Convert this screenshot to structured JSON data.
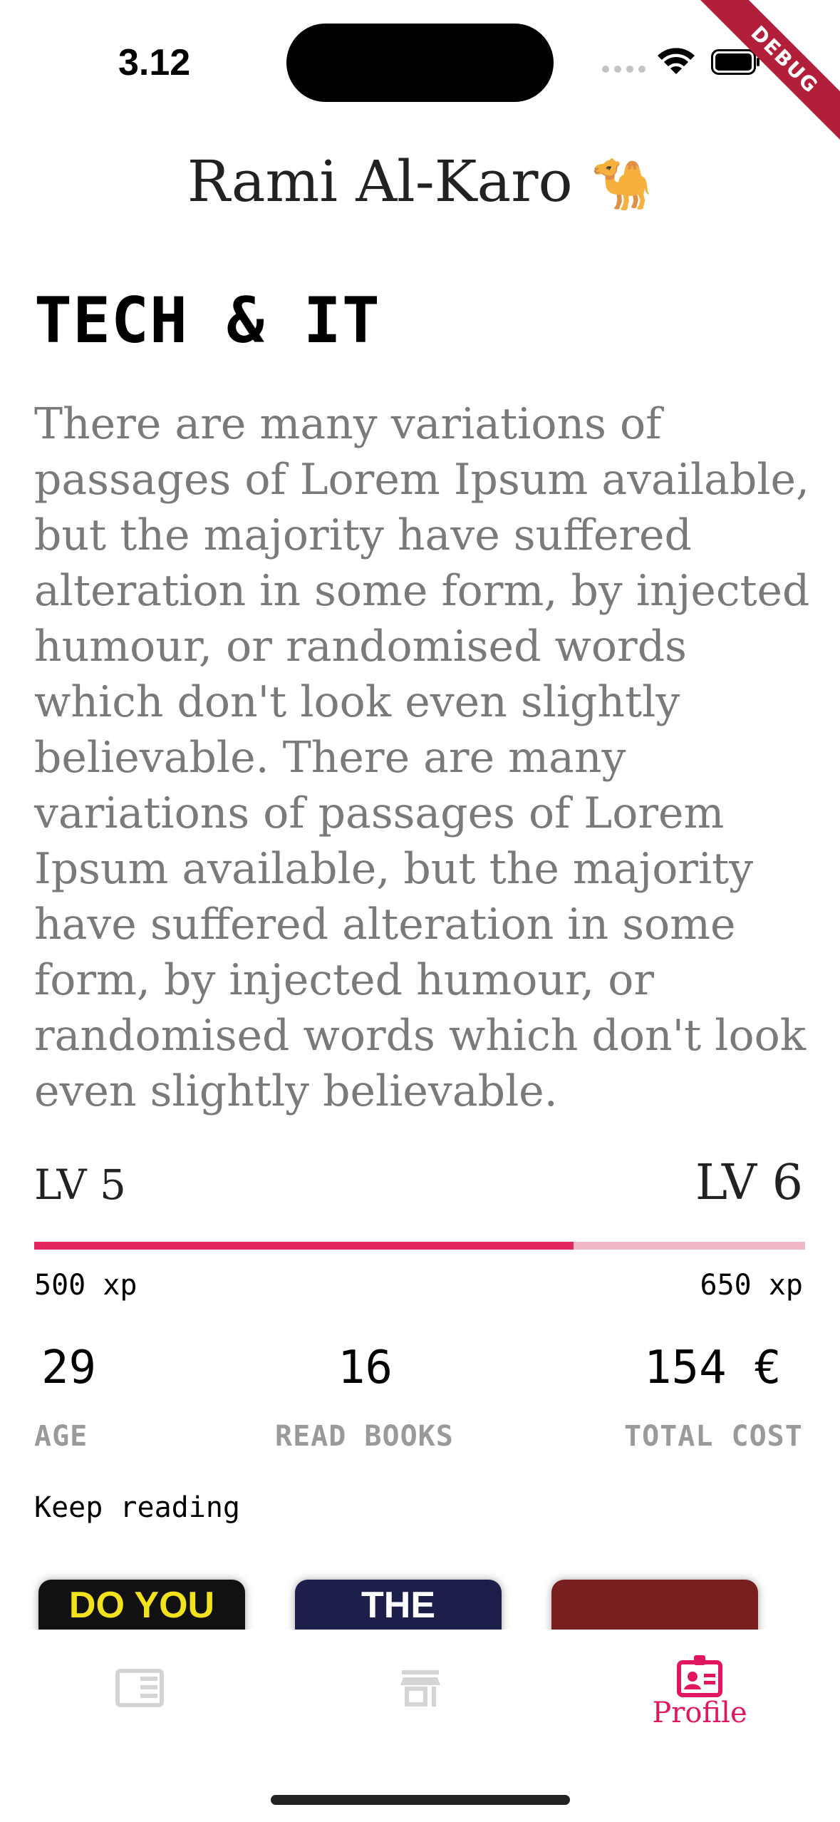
{
  "status_bar": {
    "time": "3.12"
  },
  "debug_banner": "DEBUG",
  "header": {
    "title": "Rami Al-Karo",
    "emoji": "🐪"
  },
  "category": {
    "title": "TECH & IT",
    "description": "There are many variations of passages of Lorem Ipsum available, but the majority have suffered alteration in some form, by injected humour, or randomised words which don't look even slightly believable. There are many variations of passages of Lorem Ipsum available, but the majority have suffered alteration in some form, by injected humour, or randomised words which don't look even slightly believable."
  },
  "level": {
    "current": "LV 5",
    "next": "LV 6",
    "xp_current": "500 xp",
    "xp_next": "650 xp",
    "progress_fraction": 0.7,
    "accent_color": "#e2275e",
    "track_color": "#f2b7c7"
  },
  "stats": [
    {
      "value": "29",
      "label": "AGE"
    },
    {
      "value": "16",
      "label": "READ BOOKS"
    },
    {
      "value": "154 €",
      "label": "TOTAL COST"
    }
  ],
  "keep_reading": {
    "title": "Keep reading",
    "books": [
      {
        "cover_text": "DO YOU",
        "color": "#111111"
      },
      {
        "cover_text": "THE",
        "color": "#1b1f4a"
      },
      {
        "cover_text": "",
        "color": "#7a1f1f"
      }
    ]
  },
  "bottom_nav": {
    "items": [
      {
        "icon": "reader-icon",
        "label": ""
      },
      {
        "icon": "store-icon",
        "label": ""
      },
      {
        "icon": "profile-badge-icon",
        "label": "Profile"
      }
    ],
    "active_color": "#e01760"
  }
}
